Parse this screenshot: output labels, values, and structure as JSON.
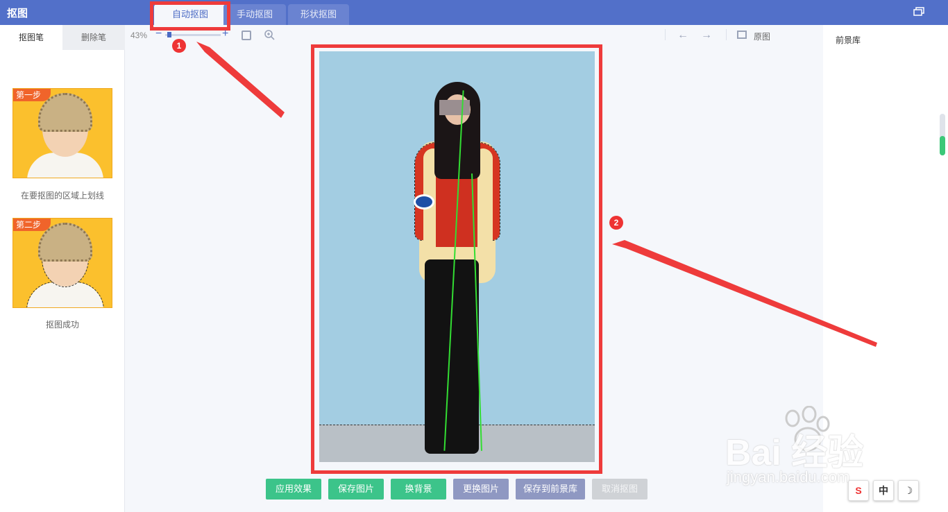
{
  "app": {
    "title": "抠图"
  },
  "tabs": [
    {
      "label": "自动抠图",
      "active": true
    },
    {
      "label": "手动抠图",
      "active": false
    },
    {
      "label": "形状抠图",
      "active": false
    }
  ],
  "left_panel": {
    "tabs": [
      {
        "label": "抠图笔",
        "active": true
      },
      {
        "label": "删除笔",
        "active": false
      }
    ],
    "steps": [
      {
        "badge": "第一步",
        "caption": "在要抠图的区域上划线"
      },
      {
        "badge": "第二步",
        "caption": "抠图成功"
      }
    ]
  },
  "toolbar": {
    "zoom_level": "43%",
    "zoom_minus": "−",
    "zoom_plus": "+",
    "undo": "←",
    "redo": "→",
    "original_label": "原图"
  },
  "right_panel": {
    "title": "前景库"
  },
  "markers": [
    "1",
    "2"
  ],
  "buttons": [
    {
      "label": "应用效果",
      "style": "green"
    },
    {
      "label": "保存图片",
      "style": "green"
    },
    {
      "label": "换背景",
      "style": "green"
    },
    {
      "label": "更换图片",
      "style": "purple"
    },
    {
      "label": "保存到前景库",
      "style": "purple"
    },
    {
      "label": "取消抠图",
      "style": "disabled"
    }
  ],
  "watermark": {
    "main": "Bai 经验",
    "sub": "jingyan.baidu.com"
  },
  "ime": [
    "S",
    "中",
    "☽"
  ],
  "colors": {
    "titlebar": "#5270c9",
    "accent_red": "#ee3b3b",
    "green_button": "#3cc48a",
    "purple_button": "#8f98c2",
    "stroke_green": "#33dd33"
  }
}
